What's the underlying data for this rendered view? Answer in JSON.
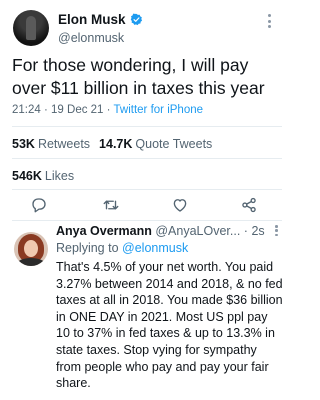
{
  "tweet": {
    "author_name": "Elon Musk",
    "author_handle": "@elonmusk",
    "text": "For those wondering, I will pay over $11 billion in taxes this year",
    "time": "21:24",
    "date": "19 Dec 21",
    "separator": "·",
    "source": "Twitter for iPhone",
    "retweets_count": "53K",
    "retweets_label": "Retweets",
    "quotes_count": "14.7K",
    "quotes_label": "Quote Tweets",
    "likes_count": "546K",
    "likes_label": "Likes"
  },
  "actions": [
    "reply-icon",
    "retweet-icon",
    "like-icon",
    "share-icon"
  ],
  "reply": {
    "author_name": "Anya Overmann",
    "author_handle": "@AnyaLOver...",
    "separator": "·",
    "time": "2s",
    "replying_label": "Replying to",
    "replying_to": "@elonmusk",
    "text": "That's 4.5% of your net worth. You paid 3.27% between 2014 and 2018, & no fed taxes at all in 2018. You made $36 billion in ONE DAY in 2021. Most US ppl pay 10 to 37% in fed taxes & up to 13.3% in state taxes. Stop vying for sympathy from people who pay and pay your fair share."
  },
  "colors": {
    "accent": "#1d9bf0",
    "text_primary": "#0f1419",
    "text_secondary": "#536471",
    "divider": "#e6ecf0"
  }
}
